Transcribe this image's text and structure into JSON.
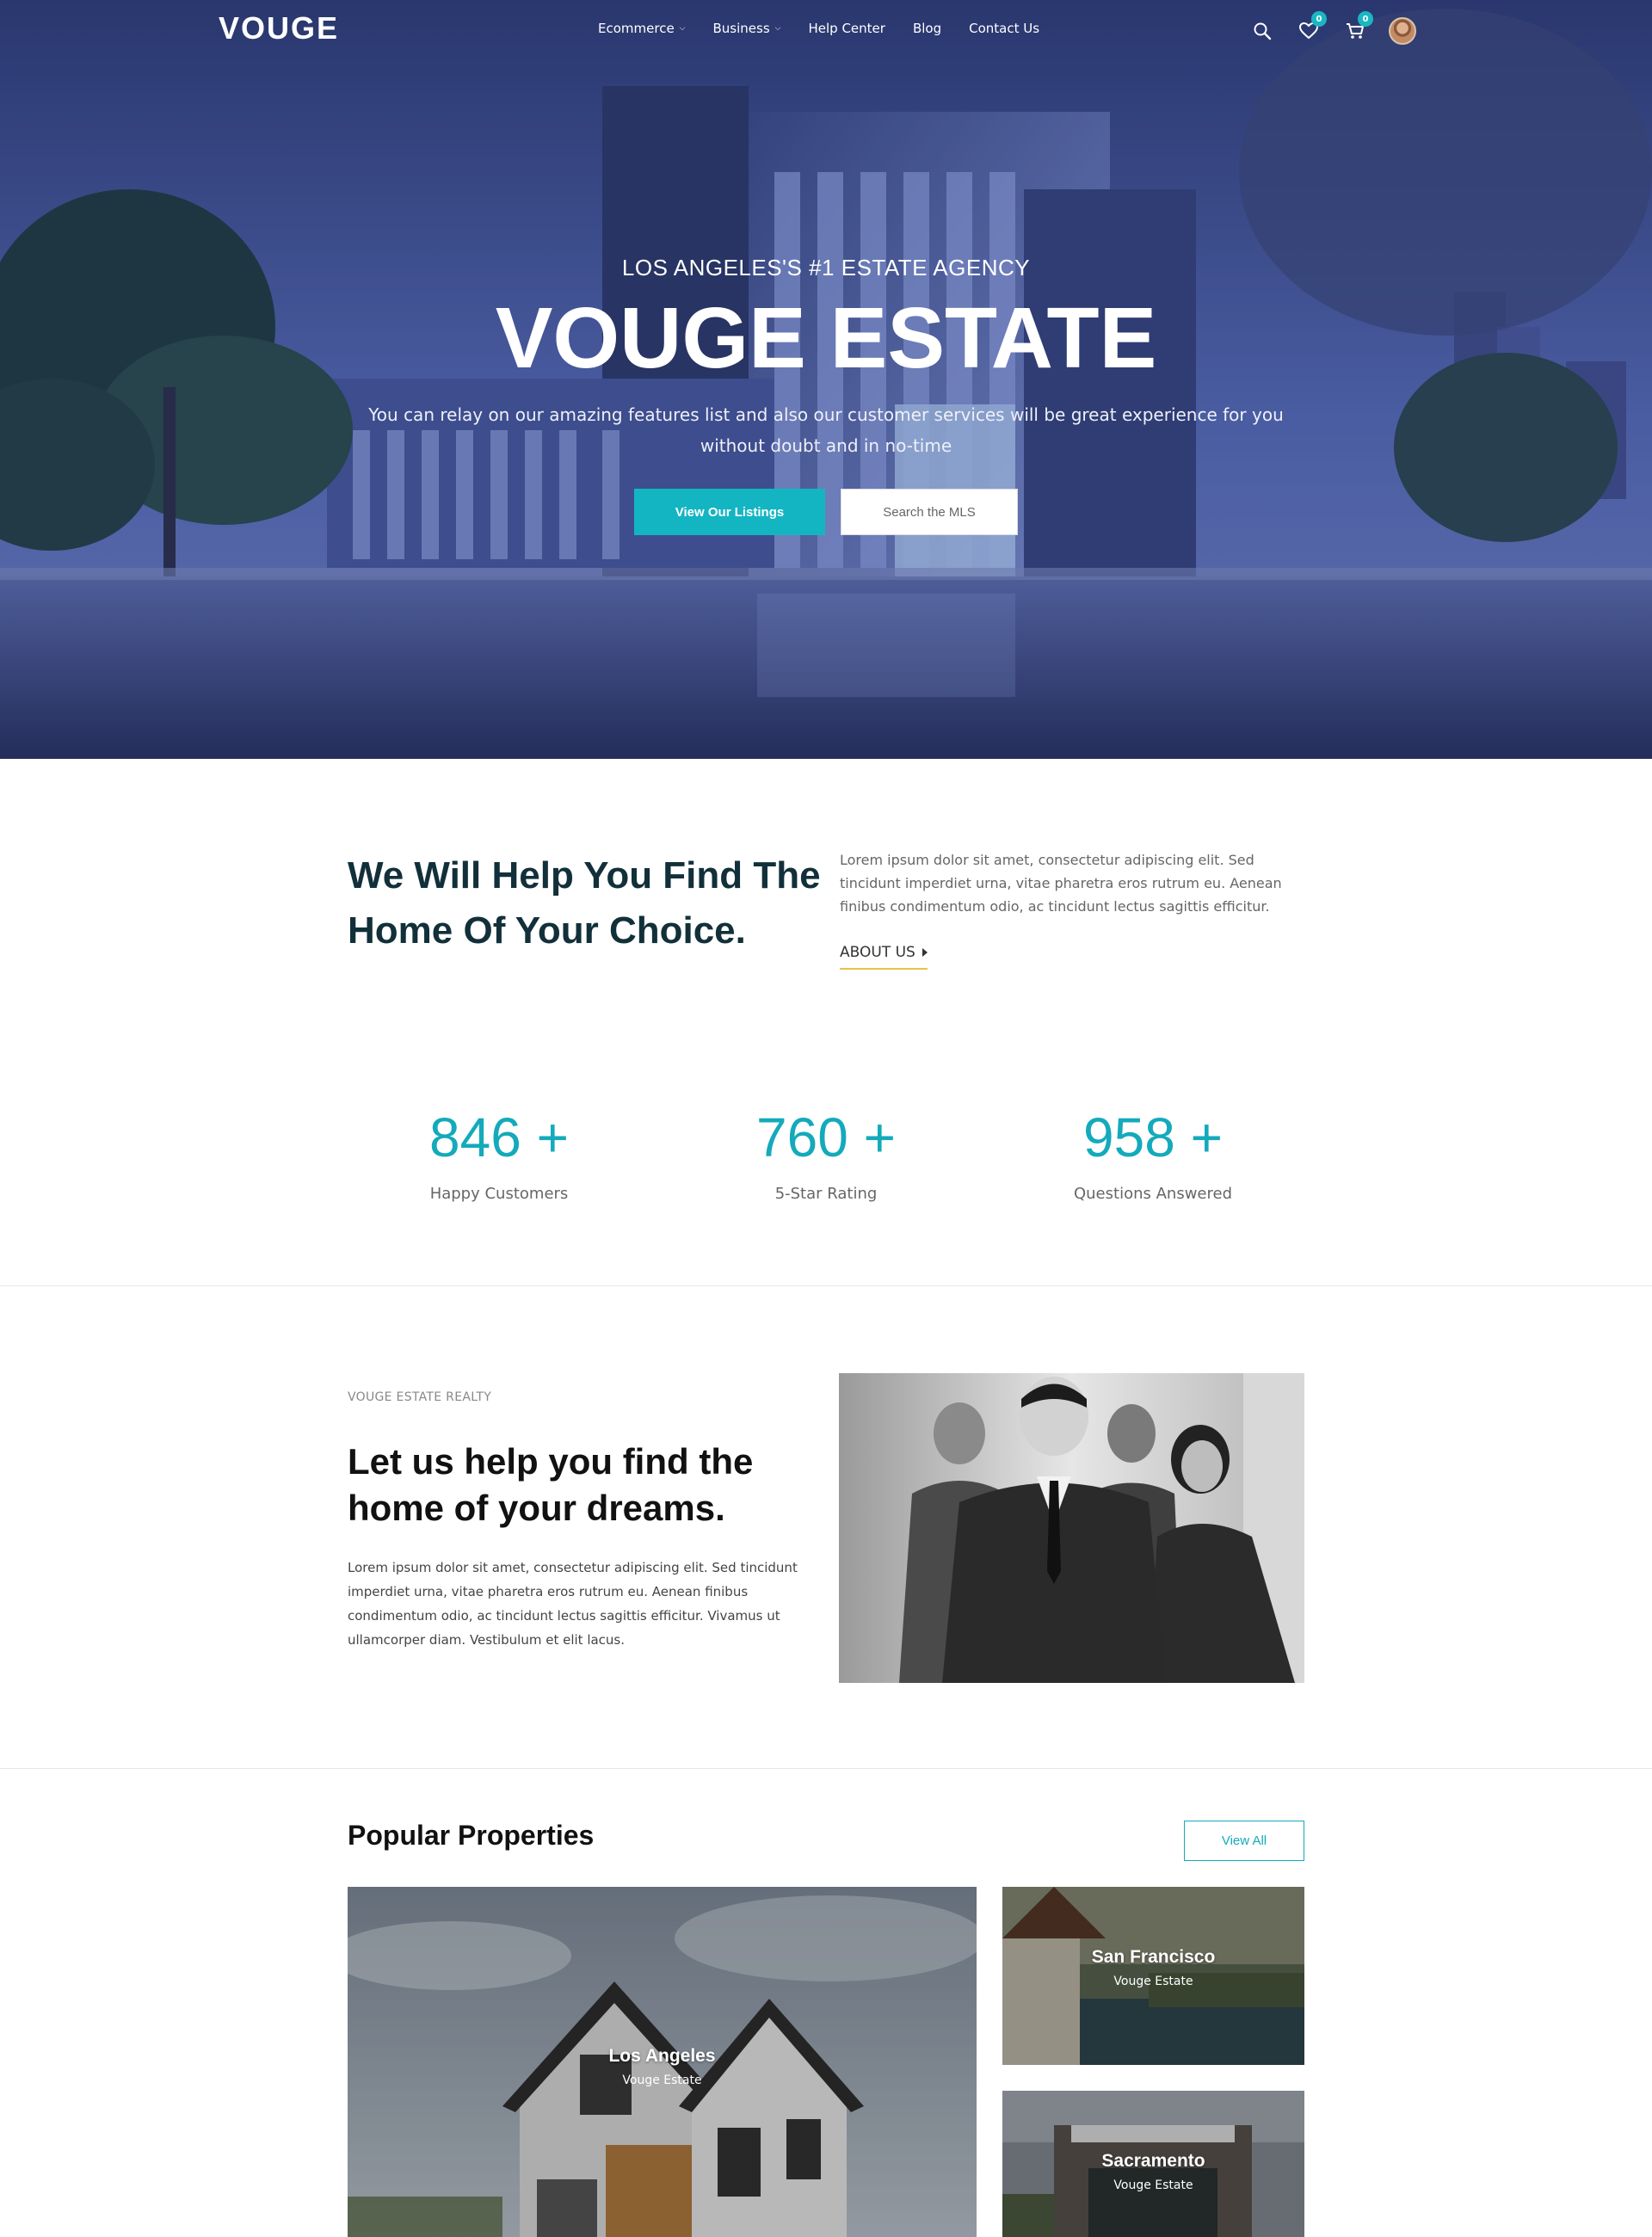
{
  "brand": {
    "logo": "VOUGE",
    "accent": "#14b5c2",
    "underline": "#e8c24a"
  },
  "nav": {
    "items": [
      {
        "label": "Ecommerce",
        "dropdown": true
      },
      {
        "label": "Business",
        "dropdown": true
      },
      {
        "label": "Help Center",
        "dropdown": false
      },
      {
        "label": "Blog",
        "dropdown": false
      },
      {
        "label": "Contact Us",
        "dropdown": false
      }
    ],
    "icons": [
      "search-icon",
      "heart-icon",
      "cart-icon",
      "avatar"
    ],
    "wishlist_count": "0",
    "cart_count": "0"
  },
  "hero": {
    "eyebrow": "LOS ANGELES'S #1 ESTATE AGENCY",
    "title": "VOUGE ESTATE",
    "description": "You can relay on our amazing features list and also our customer services will be great experience for you without doubt and in no-time",
    "primary_button": "View Our Listings",
    "secondary_button": "Search the MLS"
  },
  "about": {
    "heading": "We Will Help You Find The Home Of Your Choice.",
    "text": "Lorem ipsum dolor sit amet, consectetur adipiscing elit. Sed tincidunt imperdiet urna, vitae pharetra eros rutrum eu. Aenean finibus condimentum odio, ac tincidunt lectus sagittis efficitur.",
    "link": "ABOUT US"
  },
  "stats": [
    {
      "value": "846 +",
      "label": "Happy Customers"
    },
    {
      "value": "760 +",
      "label": "5-Star Rating"
    },
    {
      "value": "958 +",
      "label": "Questions Answered"
    }
  ],
  "realty": {
    "eyebrow": "VOUGE ESTATE REALTY",
    "title": "Let us help you find the home of your dreams.",
    "text": "Lorem ipsum dolor sit amet, consectetur adipiscing elit. Sed tincidunt imperdiet urna, vitae pharetra eros rutrum eu. Aenean finibus condimentum odio, ac tincidunt lectus sagittis efficitur. Vivamus ut ullamcorper diam. Vestibulum et elit lacus."
  },
  "properties": {
    "title": "Popular Properties",
    "view_all": "View All",
    "cards": [
      {
        "city": "Los Angeles",
        "agency": "Vouge Estate"
      },
      {
        "city": "San Francisco",
        "agency": "Vouge Estate"
      },
      {
        "city": "Sacramento",
        "agency": "Vouge Estate"
      }
    ]
  }
}
